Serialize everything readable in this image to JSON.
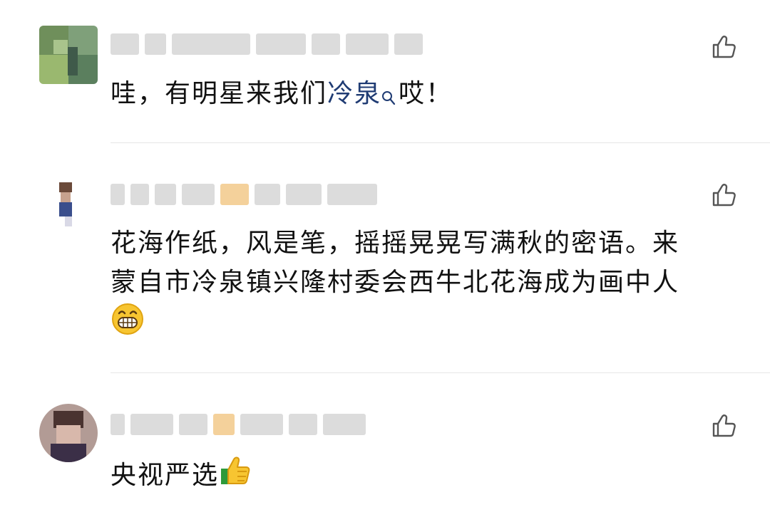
{
  "comments": [
    {
      "text_before_link": "哇，有明星来我们",
      "link": "冷泉",
      "text_after_link": "哎！"
    },
    {
      "text_line1": "花海作纸，风是笔，摇摇晃晃写满秋的密语。来",
      "text_line2": "蒙自市冷泉镇兴隆村委会西牛北花海成为画中人",
      "emoji": "grinning-face-emoji"
    },
    {
      "text": "央视严选",
      "emoji": "thumbs-up-emoji"
    }
  ],
  "icons": {
    "like": "thumbs-up-outline-icon",
    "search": "search-icon"
  },
  "colors": {
    "link": "#1f3b73",
    "text": "#111111",
    "divider": "#e6e6e6",
    "icon": "#555555"
  }
}
